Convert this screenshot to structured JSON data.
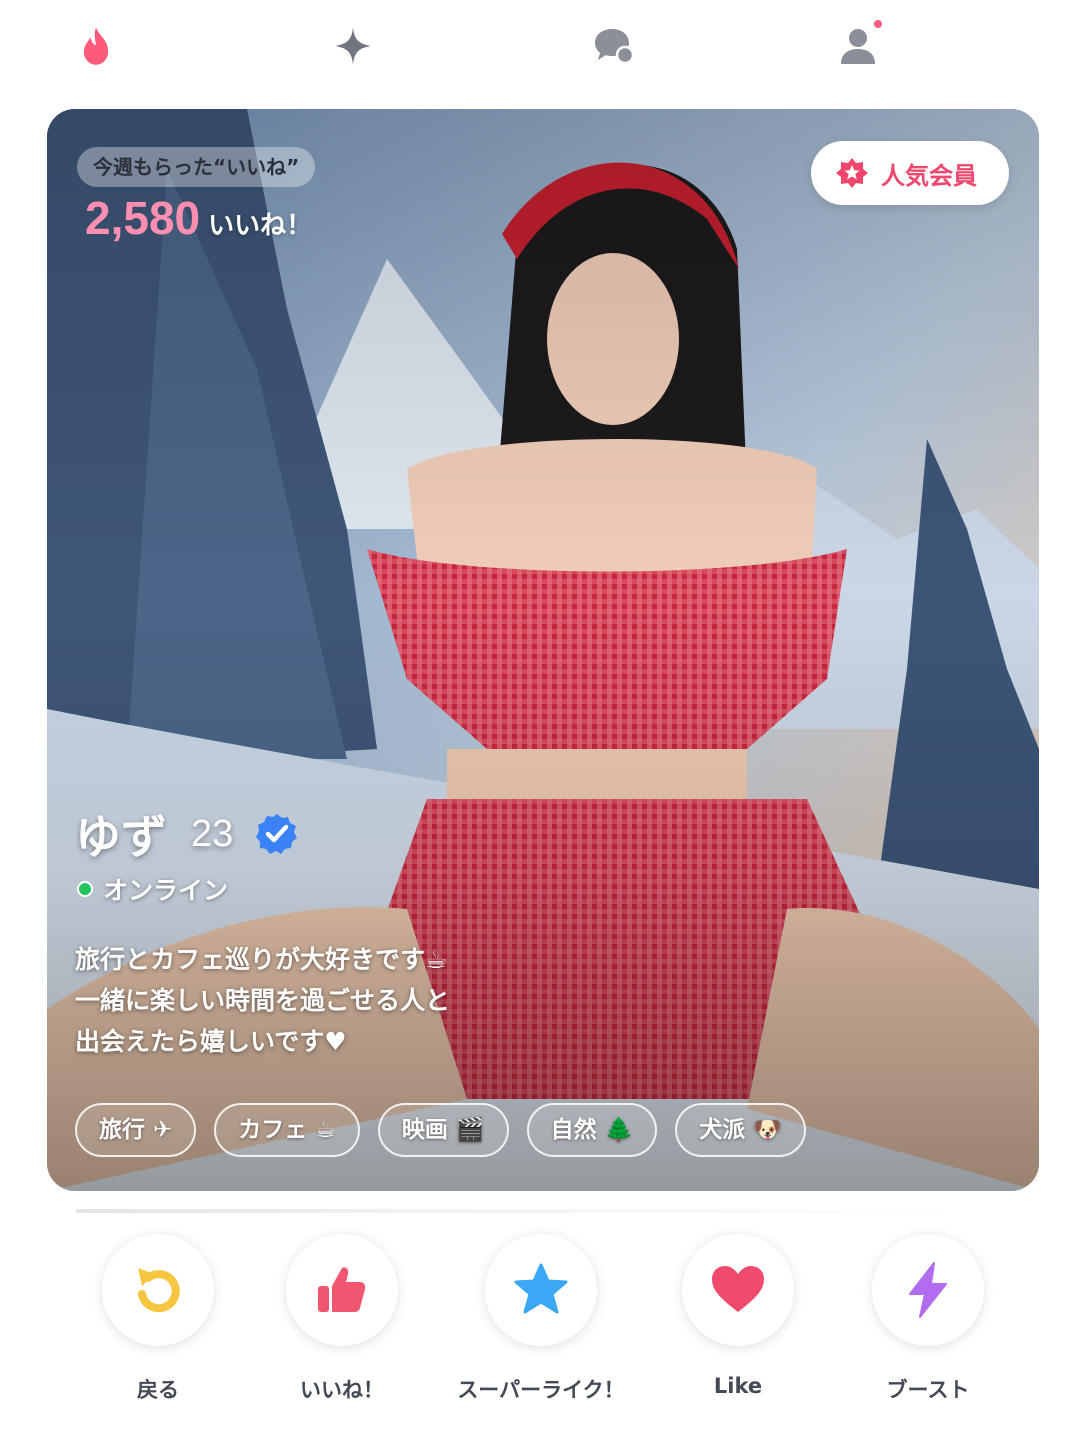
{
  "nav": {
    "items": [
      {
        "name": "flame",
        "color": "#ff5a7a"
      },
      {
        "name": "sparkle",
        "color": "#707580"
      },
      {
        "name": "chat",
        "color": "#8a8f99"
      },
      {
        "name": "profile",
        "color": "#8a8f99",
        "notification_dot": true
      }
    ],
    "notification_color": "#ff5a7a"
  },
  "card": {
    "likes_label": "今週もらった“いいね”",
    "likes_count": "2,580",
    "likes_suffix": "いいね！",
    "badge_label": "人気会員",
    "name": "ゆず",
    "age": "23",
    "verified": true,
    "status": "オンライン",
    "bio": [
      "旅行とカフェ巡りが大好きです☕",
      "一緒に楽しい時間を過ごせる人と",
      "出会えたら嬉しいです♥"
    ],
    "tags": [
      "旅行 ✈",
      "カフェ ☕",
      "映画 🎬",
      "自然 🌲",
      "犬派 🐶"
    ]
  },
  "actions": [
    {
      "label": "戻る",
      "icon": "undo-icon",
      "color": "#f6c640"
    },
    {
      "label": "いいね！",
      "icon": "thumbs-up-icon",
      "color": "#f0566e"
    },
    {
      "label": "スーパーライク！",
      "icon": "star-icon",
      "color": "#3aa8f5"
    },
    {
      "label": "Like",
      "icon": "heart-icon",
      "color": "#f04a6e"
    },
    {
      "label": "ブースト",
      "icon": "lightning-icon",
      "color": "#b26cf0"
    }
  ]
}
